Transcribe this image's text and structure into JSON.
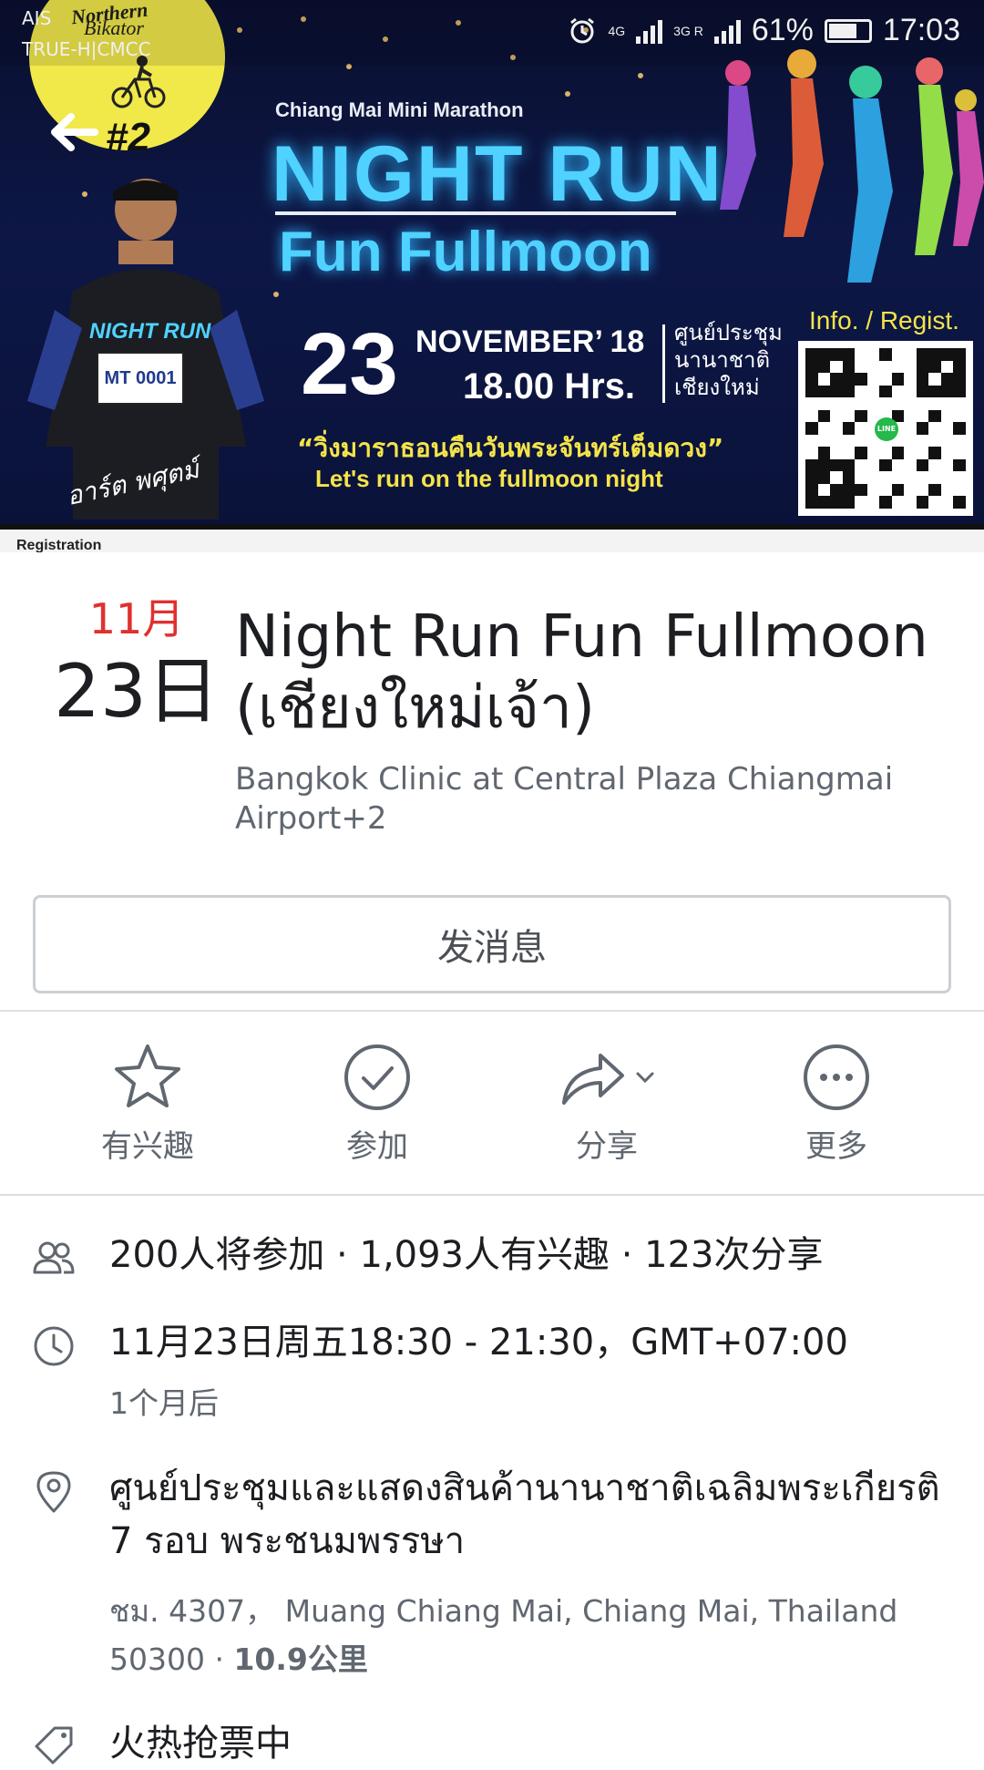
{
  "status_bar": {
    "carrier_1": "AIS",
    "carrier_2": "TRUE-H|CMCC",
    "network_1": "4G",
    "network_2": "3G R",
    "battery": "61%",
    "time": "17:03"
  },
  "cover": {
    "badge_title": "Northern",
    "badge_subtitle": "Bikator",
    "badge_number": "#2",
    "event_series": "Chiang Mai Mini Marathon",
    "title_line1": "NIGHT RUN",
    "title_line2": "Fun Fullmoon",
    "day": "23",
    "month_year": "NOVEMBER’ 18",
    "time": "18.00 Hrs.",
    "venue_thai": "ศูนย์ประชุม นานาชาติ เชียงใหม่",
    "tagline_thai": "“วิ่งมาราธอนคืนวันพระจันทร์เต็มดวง”",
    "tagline_en": "Let's run on the fullmoon night",
    "info_label": "Info. / Regist.",
    "shirt_text": "NIGHT RUN",
    "bib_number": "MT 0001",
    "signature": "อาร์ต พศุตม์",
    "bottom_label": "Registration",
    "qr_logo": "LINE"
  },
  "event": {
    "month": "11月",
    "day": "23日",
    "title": "Night Run Fun Fullmoon (เชียงใหม่เจ้า)",
    "location": "Bangkok Clinic at Central Plaza Chiangmai Airport+2"
  },
  "message_button": "发消息",
  "actions": [
    {
      "label": "有兴趣",
      "icon": "star-icon"
    },
    {
      "label": "参加",
      "icon": "check-circle-icon"
    },
    {
      "label": "分享",
      "icon": "share-arrow-icon"
    },
    {
      "label": "更多",
      "icon": "more-dots-icon"
    }
  ],
  "details": {
    "attendance": "200人将参加 · 1,093人有兴趣 · 123次分享",
    "datetime": "11月23日周五18:30 - 21:30，GMT+07:00",
    "relative_time": "1个月后",
    "venue_name": "ศูนย์ประชุมและแสดงสินค้านานาชาติเฉลิมพระเกียรติ 7 รอบ พระชนมพรรษา",
    "address": "ชม. 4307， Muang Chiang Mai, Chiang Mai, Thailand 50300 · ",
    "distance": "10.9公里",
    "tickets": "火热抢票中"
  },
  "colors": {
    "accent_red": "#e0312f",
    "text_primary": "#1c1e21",
    "text_secondary": "#606770",
    "neon_blue": "#4fd2ff",
    "tagline_yellow": "#f4e44a"
  }
}
